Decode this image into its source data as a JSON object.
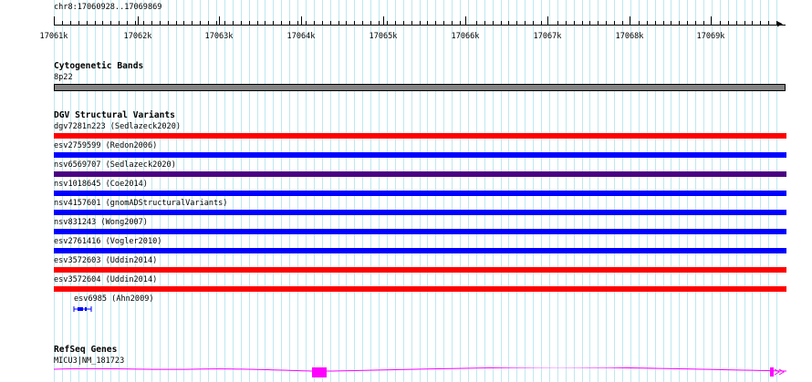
{
  "ruler": {
    "location": "chr8:17060928..17069869",
    "ticks": [
      "17061k",
      "17062k",
      "17063k",
      "17064k",
      "17065k",
      "17066k",
      "17067k",
      "17068k",
      "17069k"
    ]
  },
  "cytoband_track": {
    "title": "Cytogenetic Bands",
    "band_label": "8p22",
    "band_color": "#848484"
  },
  "dgv_track": {
    "title": "DGV Structural Variants",
    "features": [
      {
        "label": "dgv7281n223 (Sedlazeck2020)",
        "color": "#ff0000"
      },
      {
        "label": "esv2759599 (Redon2006)",
        "color": "#0000ff"
      },
      {
        "label": "nsv6569707 (Sedlazeck2020)",
        "color": "#4b0082"
      },
      {
        "label": "nsv1018645 (Coe2014)",
        "color": "#0000ff"
      },
      {
        "label": "nsv4157601 (gnomADStructuralVariants)",
        "color": "#0000ff"
      },
      {
        "label": "nsv831243 (Wong2007)",
        "color": "#0000ff"
      },
      {
        "label": "esv2761416 (Vogler2010)",
        "color": "#0000ff"
      },
      {
        "label": "esv3572603 (Uddin2014)",
        "color": "#ff0000"
      },
      {
        "label": "esv3572604 (Uddin2014)",
        "color": "#ff0000"
      }
    ],
    "small_feature": {
      "label": "esv6985 (Ahn2009)",
      "color": "#0000ff"
    }
  },
  "refseq_track": {
    "title": "RefSeq Genes",
    "gene_label": "MICU3|NM_181723",
    "gene_color": "#ff00ff"
  }
}
